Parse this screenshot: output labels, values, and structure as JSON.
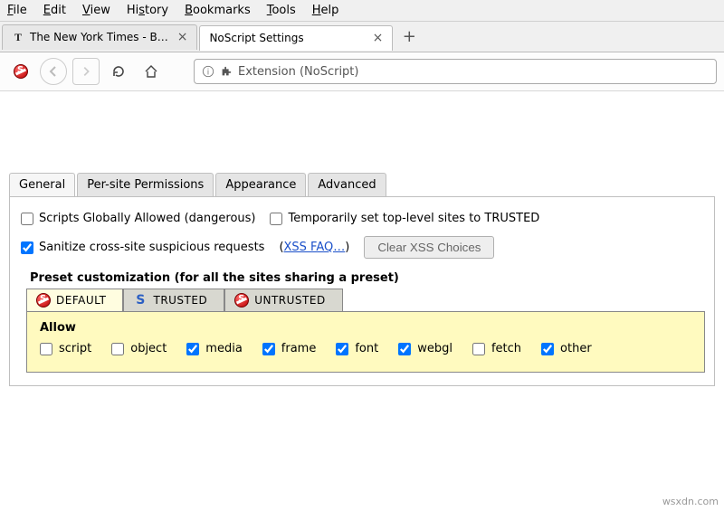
{
  "menubar": {
    "file": "File",
    "edit": "Edit",
    "view": "View",
    "history": "History",
    "bookmarks": "Bookmarks",
    "tools": "Tools",
    "help": "Help"
  },
  "tabs": {
    "tab1_title": "The New York Times - B…",
    "tab2_title": "NoScript Settings"
  },
  "url_label": "Extension (NoScript)",
  "settings_tabs": {
    "general": "General",
    "per_site": "Per-site Permissions",
    "appearance": "Appearance",
    "advanced": "Advanced"
  },
  "options": {
    "scripts_global": "Scripts Globally Allowed (dangerous)",
    "temp_trusted": "Temporarily set top-level sites to TRUSTED",
    "sanitize": "Sanitize cross-site suspicious requests",
    "xss_link": "XSS FAQ…",
    "clear_xss": "Clear XSS Choices"
  },
  "preset": {
    "heading": "Preset customization (for all the sites sharing a preset)",
    "default": "DEFAULT",
    "trusted": "TRUSTED",
    "untrusted": "UNTRUSTED",
    "allow": "Allow",
    "perms": {
      "script": "script",
      "object": "object",
      "media": "media",
      "frame": "frame",
      "font": "font",
      "webgl": "webgl",
      "fetch": "fetch",
      "other": "other"
    }
  },
  "watermark": "wsxdn.com"
}
